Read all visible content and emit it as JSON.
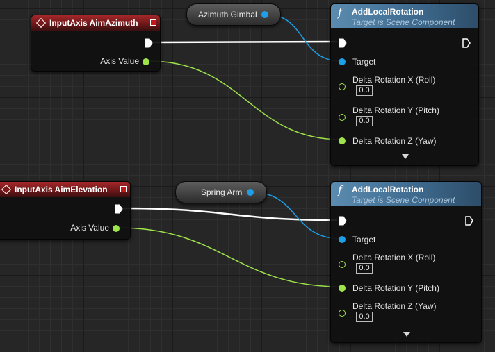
{
  "nodes": {
    "event_azimuth": {
      "title": "InputAxis AimAzimuth",
      "output_label": "Axis Value"
    },
    "event_elevation": {
      "title": "InputAxis AimElevation",
      "output_label": "Axis Value"
    },
    "var_azimuth": {
      "label": "Azimuth Gimbal"
    },
    "var_spring": {
      "label": "Spring Arm"
    },
    "func_top": {
      "title": "AddLocalRotation",
      "subtitle": "Target is Scene Component",
      "target_label": "Target",
      "pins": [
        {
          "label": "Delta Rotation X (Roll)",
          "value": "0.0",
          "connected": false
        },
        {
          "label": "Delta Rotation Y (Pitch)",
          "value": "0.0",
          "connected": false
        },
        {
          "label": "Delta Rotation Z (Yaw)",
          "value": "",
          "connected": true
        }
      ]
    },
    "func_bottom": {
      "title": "AddLocalRotation",
      "subtitle": "Target is Scene Component",
      "target_label": "Target",
      "pins": [
        {
          "label": "Delta Rotation X (Roll)",
          "value": "0.0",
          "connected": false
        },
        {
          "label": "Delta Rotation Y (Pitch)",
          "value": "",
          "connected": true
        },
        {
          "label": "Delta Rotation Z (Yaw)",
          "value": "0.0",
          "connected": false
        }
      ]
    }
  },
  "colors": {
    "exec_wire": "#ffffff",
    "float_wire": "#9ee34a",
    "object_wire": "#1e9fe8",
    "event_header": "#a5282a",
    "function_header": "#5b8bb0"
  },
  "icons": [
    "event-diamond-icon",
    "function-f-icon",
    "exec-pin-icon",
    "float-pin-icon",
    "object-pin-icon",
    "expand-arrow-icon",
    "delegate-square-icon"
  ]
}
